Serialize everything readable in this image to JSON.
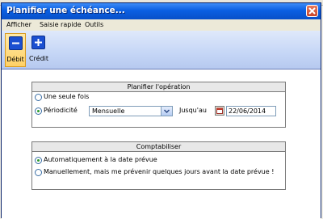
{
  "window": {
    "title": "Planifier une échéance..."
  },
  "menu": [
    "Afficher",
    "Saisie rapide",
    "Outils"
  ],
  "toolbar": {
    "debit": "Débit",
    "credit": "Crédit"
  },
  "planifier": {
    "header": "Planifier l'opération",
    "once_label": "Une seule fois",
    "periodicite_label": "Périodicité",
    "periodicite_value": "Mensuelle",
    "jusquau_label": "Jusqu'au",
    "date_value": "22/06/2014",
    "selected": "periodicite"
  },
  "comptabiliser": {
    "header": "Comptabiliser",
    "auto_label": "Automatiquement à la date prévue",
    "manual_label": "Manuellement, mais me prévenir quelques jours avant la date prévue !",
    "selected": "auto"
  },
  "colors": {
    "titlebar": "#0a5fe2",
    "active_button": "#ffd166",
    "radio_check": "#2a9a2a"
  }
}
